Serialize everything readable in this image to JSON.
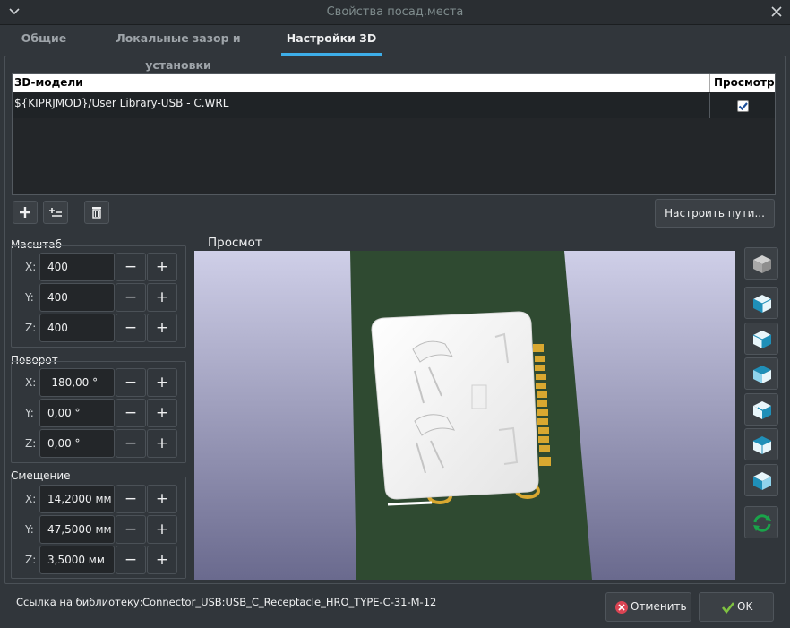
{
  "window": {
    "title": "Свойства посад.места"
  },
  "tabs": [
    {
      "label": "Общие"
    },
    {
      "label": "Локальные зазор и установки"
    },
    {
      "label": "Настройки 3D"
    }
  ],
  "models_table": {
    "headers": {
      "model": "3D-модели",
      "preview": "Просмотр"
    },
    "rows": [
      {
        "path": "${KIPRJMOD}/User Library-USB - C.WRL",
        "preview_checked": true
      }
    ]
  },
  "toolbar": {
    "configure_paths_label": "Настроить пути..."
  },
  "scale": {
    "label": "Масштаб",
    "x": {
      "axis": "X:",
      "value": "400"
    },
    "y": {
      "axis": "Y:",
      "value": "400"
    },
    "z": {
      "axis": "Z:",
      "value": "400"
    }
  },
  "rotation": {
    "label": "Поворот",
    "x": {
      "axis": "X:",
      "value": "-180,00 °"
    },
    "y": {
      "axis": "Y:",
      "value": "0,00 °"
    },
    "z": {
      "axis": "Z:",
      "value": "0,00 °"
    }
  },
  "offset": {
    "label": "Смещение",
    "x": {
      "axis": "X:",
      "value": "14,2000 мм"
    },
    "y": {
      "axis": "Y:",
      "value": "47,5000 мм"
    },
    "z": {
      "axis": "Z:",
      "value": "3,5000 мм"
    }
  },
  "spin": {
    "minus": "−",
    "plus": "+"
  },
  "preview": {
    "label": "Просмот"
  },
  "footer": {
    "library_link_label": "Ссылка на библиотеку:",
    "library_link_value": "Connector_USB:USB_C_Receptacle_HRO_TYPE-C-31-M-12",
    "cancel_label": "Отменить",
    "ok_label": "OK"
  },
  "colors": {
    "accent": "#3daee9",
    "pcb_green": "#2f4a31",
    "pad_gold": "#d9a830",
    "cancel_red": "#da4453",
    "ok_green": "#7fc241"
  }
}
